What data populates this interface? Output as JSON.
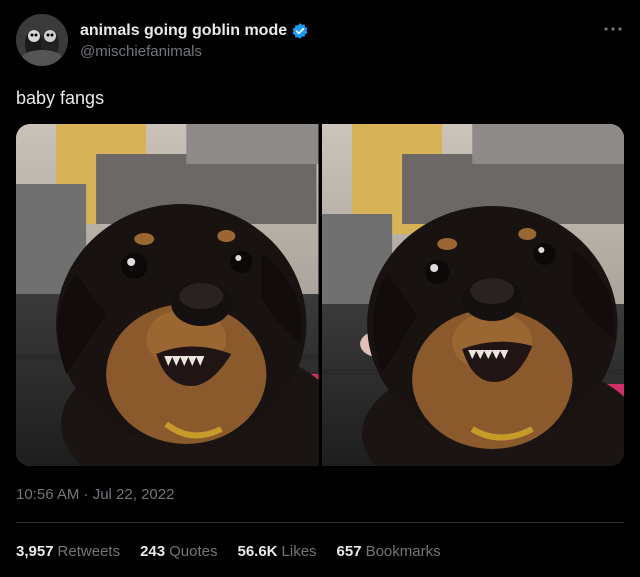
{
  "author": {
    "display_name": "animals going goblin mode",
    "handle": "@mischiefanimals",
    "verified_color": "#1d9bf0"
  },
  "tweet": {
    "text": "baby fangs",
    "timestamp": "10:56 AM · Jul 22, 2022"
  },
  "media": {
    "photo_count": 2
  },
  "stats": [
    {
      "value": "3,957",
      "label": "Retweets"
    },
    {
      "value": "243",
      "label": "Quotes"
    },
    {
      "value": "56.6K",
      "label": "Likes"
    },
    {
      "value": "657",
      "label": "Bookmarks"
    }
  ],
  "icons": {
    "verified": "verified-badge-icon",
    "more": "more-options-icon"
  }
}
